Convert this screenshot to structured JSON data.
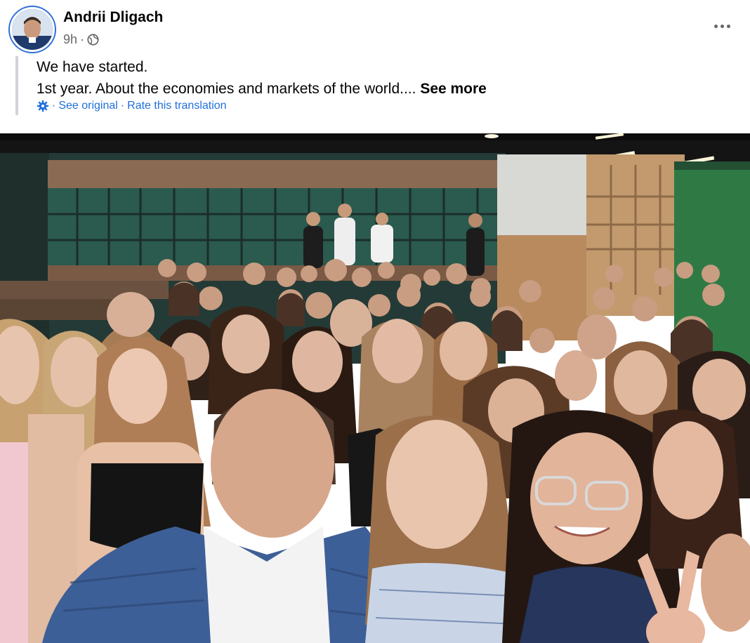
{
  "post": {
    "author": "Andrii Dligach",
    "time": "9h",
    "separator": "·",
    "privacy_icon": "globe-icon",
    "more_icon": "more-horizontal-icon",
    "text_line1": "We have started.",
    "text_line2": "1st year. About the economies and markets of the world....",
    "see_more": "See more",
    "translation": {
      "settings_icon": "gear-icon",
      "separator": "·",
      "see_original": "See original",
      "rate": "Rate this translation"
    }
  },
  "photo": {
    "icon": "group-selfie-photo"
  },
  "colors": {
    "link": "#216fdb",
    "meta_text": "#65676b",
    "wall_green": "#2f7a44"
  }
}
